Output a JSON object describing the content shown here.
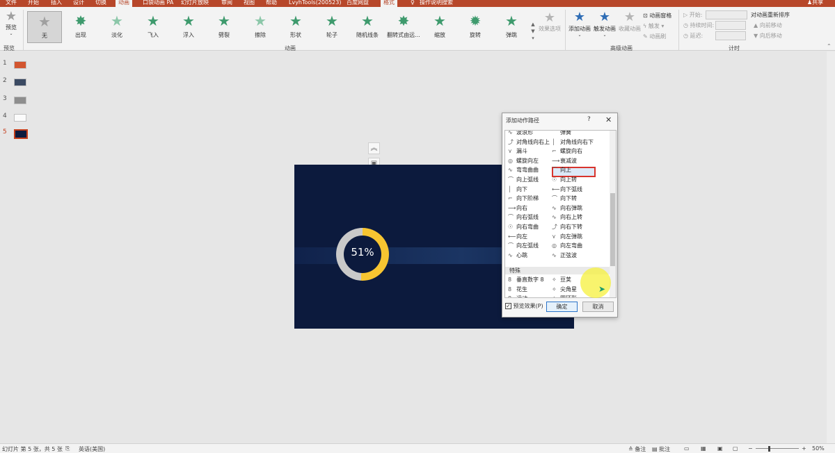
{
  "tabs": [
    "文件",
    "开始",
    "插入",
    "设计",
    "切换",
    "动画",
    "口袋动画 PA",
    "幻灯片放映",
    "审阅",
    "视图",
    "帮助",
    "LvyhTools(200523)",
    "百度网盘",
    "格式",
    "操作说明搜索"
  ],
  "share_label": "共享",
  "ribbon": {
    "preview_label": "预览",
    "preview_group": "预览",
    "animations": [
      "无",
      "出现",
      "淡化",
      "飞入",
      "浮入",
      "劈裂",
      "擦除",
      "形状",
      "轮子",
      "随机线条",
      "翻转式由远...",
      "缩放",
      "旋转",
      "弹跳"
    ],
    "effect_options": "效果选项",
    "animation_group": "动画",
    "add_animation": "添加动画",
    "animation_painter": "触发动画",
    "collect_animation": "收藏动画",
    "animation_pane": "动画窗格",
    "trigger": "触发",
    "animation_brush": "动画刷",
    "advanced_group": "高级动画",
    "start_label": "开始:",
    "duration_label": "持续时间:",
    "delay_label": "延迟:",
    "reorder_title": "对动画重新排序",
    "move_earlier": "向前移动",
    "move_later": "向后移动",
    "timing_group": "计时"
  },
  "slides": [
    "1",
    "2",
    "3",
    "4",
    "5"
  ],
  "slide_content": {
    "percent": "51%",
    "donut_fraction": 0.51
  },
  "dialog": {
    "title": "添加动作路径",
    "help": "?",
    "close": "✕",
    "items": [
      [
        "波浪形",
        "弹簧"
      ],
      [
        "对角线向右上",
        "对角线向右下"
      ],
      [
        "漏斗",
        "螺旋向右"
      ],
      [
        "螺旋向左",
        "衰减波"
      ],
      [
        "弯弯曲曲",
        "向上"
      ],
      [
        "向上弧线",
        "向上转"
      ],
      [
        "向下",
        "向下弧线"
      ],
      [
        "向下阶梯",
        "向下转"
      ],
      [
        "向右",
        "向右弹跳"
      ],
      [
        "向右弧线",
        "向右上转"
      ],
      [
        "向右弯曲",
        "向右下转"
      ],
      [
        "向左",
        "向左弹跳"
      ],
      [
        "向左弧线",
        "向左弯曲"
      ],
      [
        "心跳",
        "正弦波"
      ]
    ],
    "section": "特殊",
    "special_items": [
      [
        "垂直数字 8",
        "豆荚"
      ],
      [
        "花生",
        "尖角星"
      ],
      [
        "运动",
        "圆环形"
      ]
    ],
    "preview_effect": "预览效果(P)",
    "ok": "确定",
    "cancel": "取消"
  },
  "status": {
    "slide_info": "幻灯片 第 5 张，共 5 张",
    "language": "英语(美国)",
    "notes": "备注",
    "comments": "批注",
    "zoom": "50%"
  },
  "colors": {
    "accent": "#b7472a",
    "slide_bg": "#0c1a3d",
    "donut_fill": "#f7c531",
    "selection": "#d8342d"
  }
}
